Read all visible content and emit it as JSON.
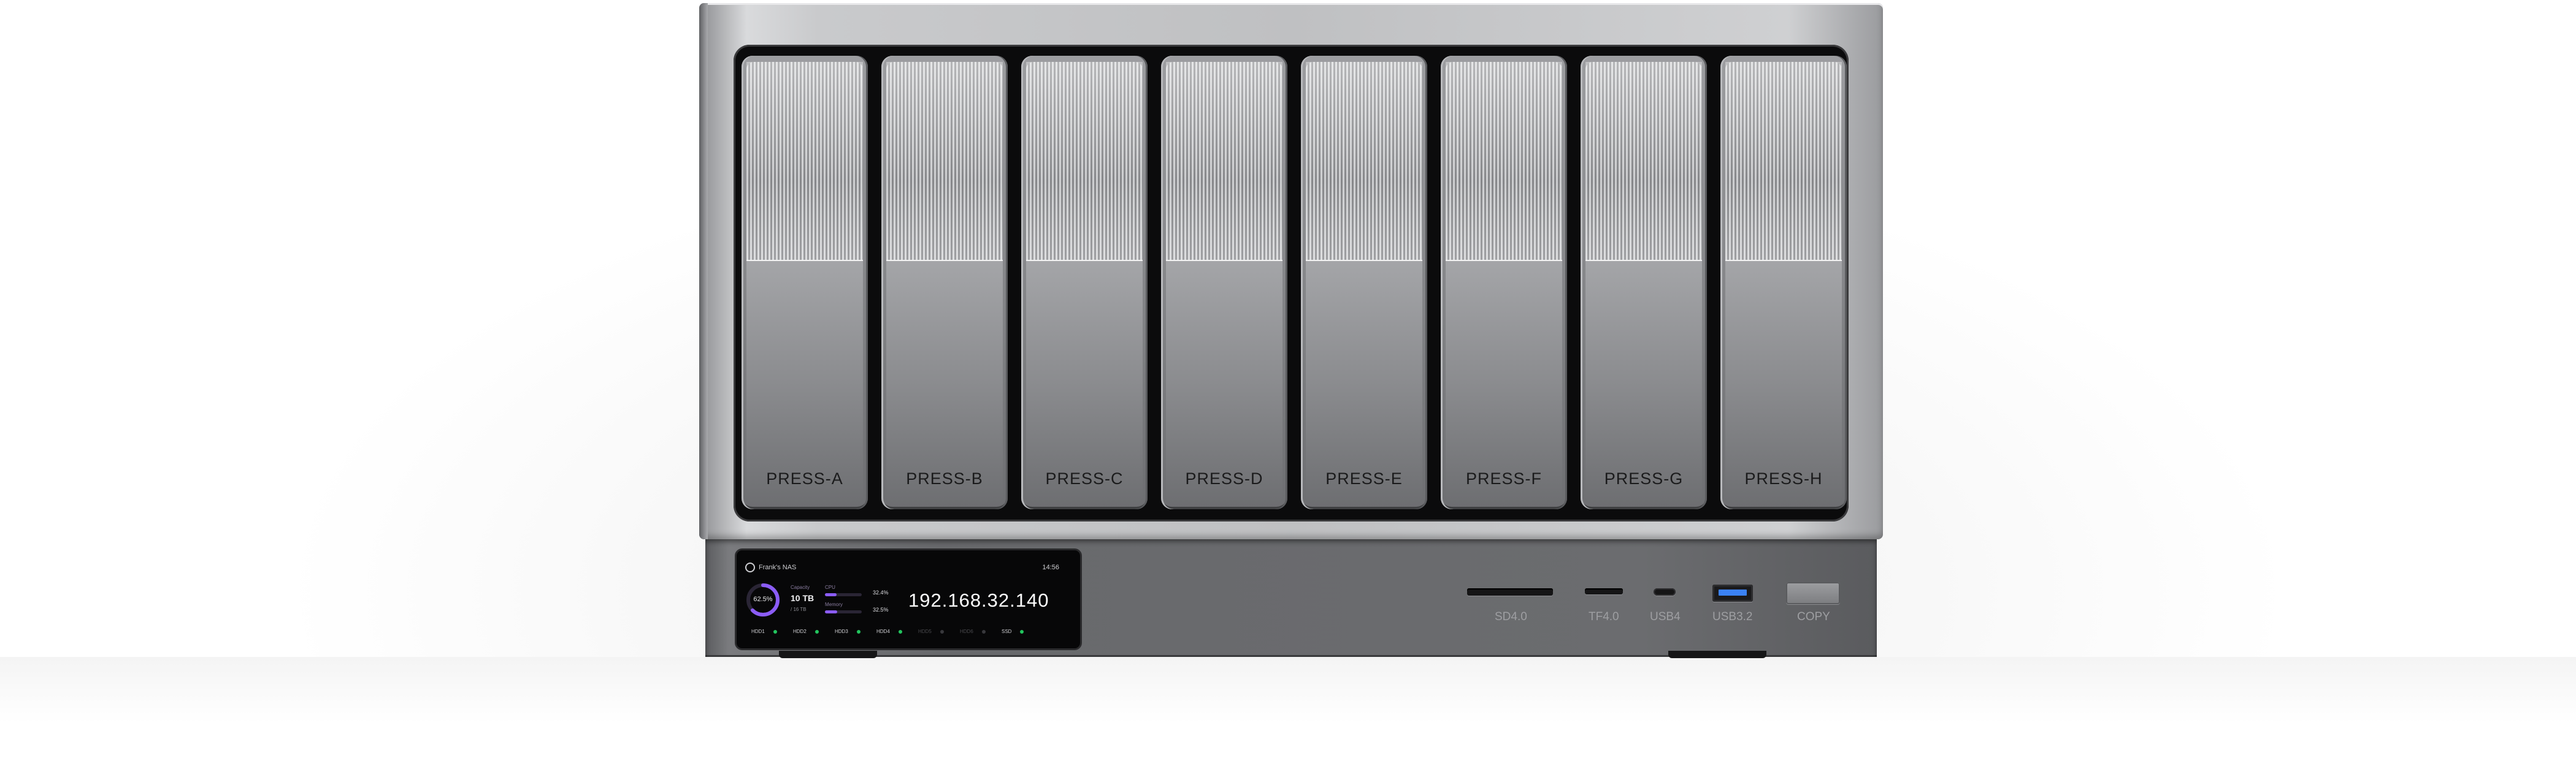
{
  "device": {
    "bays": [
      {
        "label": "PRESS-A"
      },
      {
        "label": "PRESS-B"
      },
      {
        "label": "PRESS-C"
      },
      {
        "label": "PRESS-D"
      },
      {
        "label": "PRESS-E"
      },
      {
        "label": "PRESS-F"
      },
      {
        "label": "PRESS-G"
      },
      {
        "label": "PRESS-H"
      }
    ],
    "display": {
      "name": "Frank's NAS",
      "time": "14:56",
      "usage_percent": "62.5%",
      "usage_fraction": 0.625,
      "capacity_label": "Capacity",
      "capacity_value": "10 TB",
      "capacity_sub": "/ 16 TB",
      "cpu_label": "CPU",
      "cpu_value": "32.4%",
      "cpu_fraction": 0.324,
      "memory_label": "Memory",
      "memory_value": "32.5%",
      "memory_fraction": 0.325,
      "ip": "192.168.32.140",
      "disks": [
        {
          "name": "HDD1",
          "active": true
        },
        {
          "name": "HDD2",
          "active": true
        },
        {
          "name": "HDD3",
          "active": true
        },
        {
          "name": "HDD4",
          "active": true
        },
        {
          "name": "HDD5",
          "active": false
        },
        {
          "name": "HDD6",
          "active": false
        },
        {
          "name": "SSD",
          "active": true
        }
      ]
    },
    "ports": [
      {
        "label": "SD4.0"
      },
      {
        "label": "TF4.0"
      },
      {
        "label": "USB4"
      },
      {
        "label": "USB3.2"
      },
      {
        "label": "COPY"
      }
    ],
    "colors": {
      "accent": "#8b5cf6",
      "status_on": "#22c55e",
      "usb_blue": "#3b82f6"
    }
  }
}
